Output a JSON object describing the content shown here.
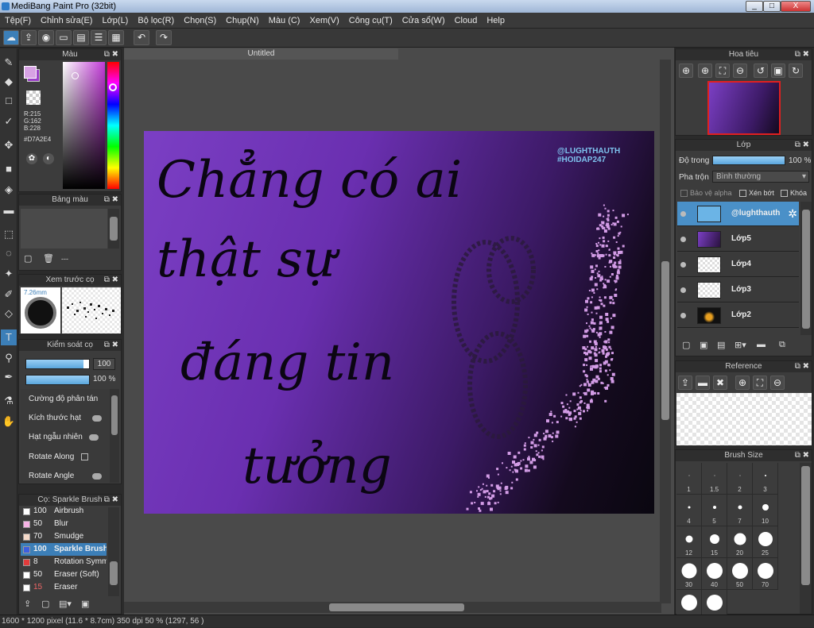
{
  "window": {
    "title": "MediBang Paint Pro (32bit)",
    "minimize": "_",
    "maximize": "□",
    "close": "X"
  },
  "menu": [
    "Tệp(F)",
    "Chỉnh sửa(E)",
    "Lớp(L)",
    "Bộ lọc(R)",
    "Chọn(S)",
    "Chụp(N)",
    "Màu (C)",
    "Xem(V)",
    "Công cụ(T)",
    "Cửa sổ(W)",
    "Cloud",
    "Help"
  ],
  "toolbar": {
    "undo": "↶",
    "redo": "↷"
  },
  "document": {
    "tab": "Untitled"
  },
  "artwork": {
    "lines": [
      "Chẳng có ai",
      "thật sự",
      "đáng tin",
      "tưởng"
    ],
    "watermark1": "@LUGHTHAUTH",
    "watermark2": "#HOIDAP247"
  },
  "color_panel": {
    "title": "Màu",
    "r": "R:215",
    "g": "G:162",
    "b": "B:228",
    "hex": "#D7A2E4",
    "primary": "#D7A2E4",
    "secondary": "#9a3fc7"
  },
  "palette_panel": {
    "title": "Bảng màu",
    "footer": "---"
  },
  "brush_preview": {
    "title": "Xem trước cọ",
    "size": "7.26mm"
  },
  "brush_control": {
    "title": "Kiểm soát cọ",
    "size_value": "100",
    "opacity_value": "100 %",
    "opacity_fraction": 0.8,
    "options": [
      "Cường độ phân tán",
      "Kích thước hạt",
      "Hạt ngẫu nhiên",
      "Rotate Along",
      "Rotate Angle"
    ]
  },
  "brush_list": {
    "title": "Cọ: Sparkle Brush",
    "items": [
      {
        "num": "100",
        "name": "Airbrush",
        "color": "#ffffff"
      },
      {
        "num": "50",
        "name": "Blur",
        "color": "#f7b3e6"
      },
      {
        "num": "70",
        "name": "Smudge",
        "color": "#f5d9c8"
      },
      {
        "num": "100",
        "name": "Sparkle Brush",
        "color": "#3d5fe0"
      },
      {
        "num": "8",
        "name": "Rotation Symm",
        "color": "#e23b3b"
      },
      {
        "num": "50",
        "name": "Eraser (Soft)",
        "color": "#ffffff"
      },
      {
        "num": "15",
        "name": "Eraser",
        "color": "#ffffff"
      }
    ]
  },
  "navigator": {
    "title": "Hoa tiêu"
  },
  "layer_panel": {
    "title": "Lớp",
    "opacity_label": "Độ trong",
    "opacity_value": "100 %",
    "blend_label": "Pha trộn",
    "blend_value": "Bình thường",
    "protect_alpha": "Bảo vệ alpha",
    "clipping": "Xén bớt",
    "lock": "Khóa",
    "layers": [
      "@lughthauth",
      "Lớp5",
      "Lớp4",
      "Lớp3",
      "Lớp2"
    ]
  },
  "reference_panel": {
    "title": "Reference"
  },
  "brush_size_panel": {
    "title": "Brush Size",
    "sizes": [
      "1",
      "1.5",
      "2",
      "3",
      "4",
      "5",
      "7",
      "10",
      "12",
      "15",
      "20",
      "25",
      "30",
      "40",
      "50",
      "70",
      "",
      ""
    ]
  },
  "status": {
    "text": "1600 * 1200 pixel   (11.6 * 8.7cm)   350 dpi   50 %   (1297, 56 )"
  }
}
